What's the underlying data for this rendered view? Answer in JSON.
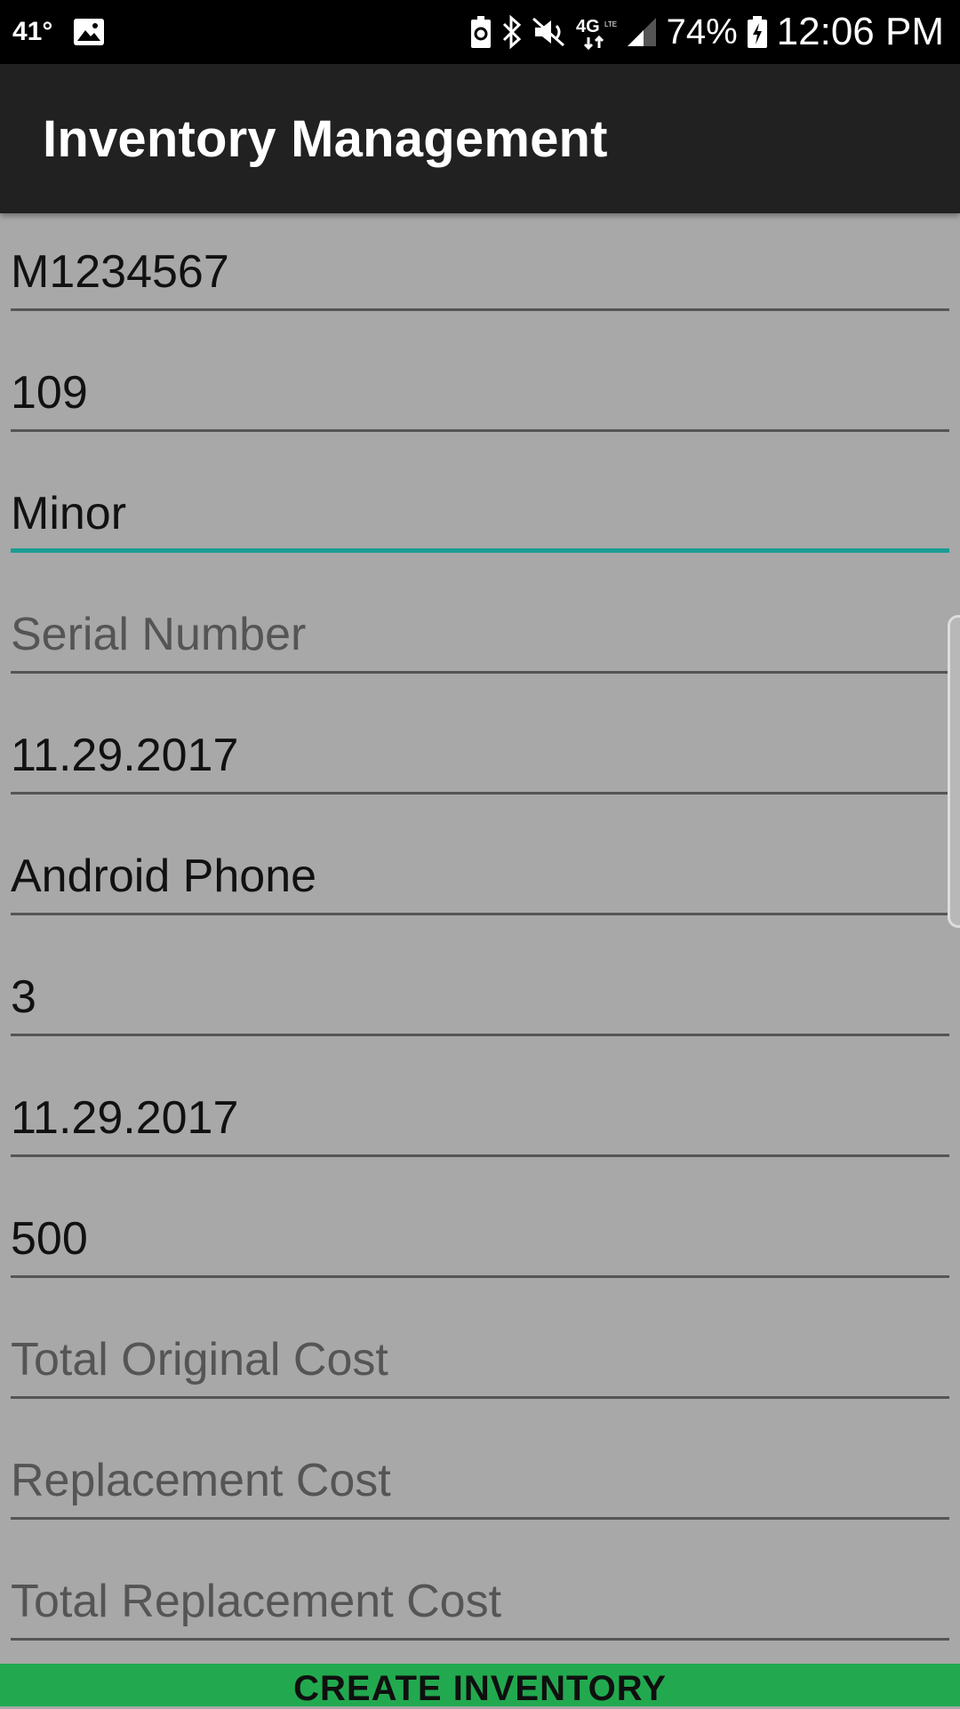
{
  "status_bar": {
    "temperature": "41°",
    "battery_percent": "74%",
    "time": "12:06 PM",
    "icons": [
      "image-icon",
      "battery-saver-icon",
      "bluetooth-icon",
      "mute-icon",
      "lte-4g-icon",
      "signal-icon",
      "battery-icon"
    ]
  },
  "app_bar": {
    "title": "Inventory Management"
  },
  "form": {
    "fields": [
      {
        "name": "item-id-field",
        "value": "M1234567",
        "placeholder": ""
      },
      {
        "name": "number-field",
        "value": "109",
        "placeholder": ""
      },
      {
        "name": "category-field",
        "value": "Minor",
        "placeholder": "",
        "focused": true
      },
      {
        "name": "serial-number-field",
        "value": "",
        "placeholder": "Serial Number"
      },
      {
        "name": "date-field-1",
        "value": "11.29.2017",
        "placeholder": ""
      },
      {
        "name": "description-field",
        "value": "Android Phone",
        "placeholder": ""
      },
      {
        "name": "quantity-field",
        "value": "3",
        "placeholder": ""
      },
      {
        "name": "date-field-2",
        "value": "11.29.2017",
        "placeholder": ""
      },
      {
        "name": "original-cost-field",
        "value": "500",
        "placeholder": ""
      },
      {
        "name": "total-original-cost-field",
        "value": "",
        "placeholder": "Total Original Cost"
      },
      {
        "name": "replacement-cost-field",
        "value": "",
        "placeholder": "Replacement Cost"
      },
      {
        "name": "total-replacement-cost-field",
        "value": "",
        "placeholder": "Total Replacement Cost"
      }
    ]
  },
  "actions": {
    "create_label": "CREATE INVENTORY"
  },
  "colors": {
    "status_bar_bg": "#000000",
    "app_bar_bg": "#212121",
    "content_bg": "#a8a8a8",
    "focus_accent": "#1a9e94",
    "button_bg": "#22a94f"
  }
}
